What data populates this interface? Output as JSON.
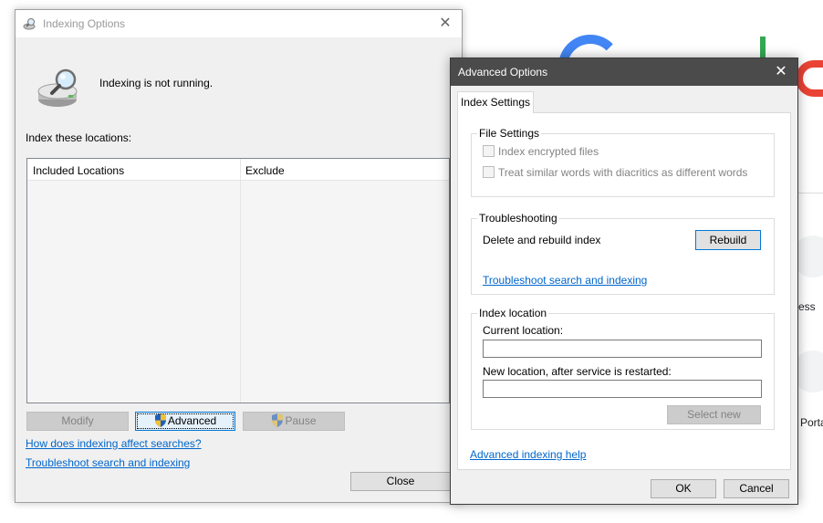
{
  "indexing_window": {
    "title": "Indexing Options",
    "close_glyph": "✕",
    "status_text": "Indexing is not running.",
    "locations_label": "Index these locations:",
    "columns": [
      "Included Locations",
      "Exclude"
    ],
    "buttons": {
      "modify": "Modify",
      "advanced": "Advanced",
      "pause": "Pause",
      "close": "Close"
    },
    "links": {
      "how_affect": "How does indexing affect searches?",
      "troubleshoot": "Troubleshoot search and indexing"
    }
  },
  "advanced_window": {
    "title": "Advanced Options",
    "close_glyph": "✕",
    "tab": "Index Settings",
    "file_settings": {
      "legend": "File Settings",
      "options": [
        "Index encrypted files",
        "Treat similar words with diacritics as different words"
      ]
    },
    "troubleshooting": {
      "legend": "Troubleshooting",
      "rebuild_label": "Delete and rebuild index",
      "rebuild_button": "Rebuild",
      "link": "Troubleshoot search and indexing"
    },
    "index_location": {
      "legend": "Index location",
      "current_label": "Current location:",
      "current_value": "",
      "new_label": "New location, after service is restarted:",
      "new_value": "",
      "select_button": "Select new"
    },
    "help_link": "Advanced indexing help",
    "ok_button": "OK",
    "cancel_button": "Cancel"
  },
  "background": {
    "text_1": "ess",
    "text_2": "Porta"
  },
  "colors": {
    "link": "#0066cc",
    "dark_titlebar": "#4b4b4b",
    "dialog_bg": "#f0f0f0"
  },
  "icons": [
    "indexing-app-icon",
    "magnifier-drive-icon",
    "uac-shield-icon"
  ]
}
